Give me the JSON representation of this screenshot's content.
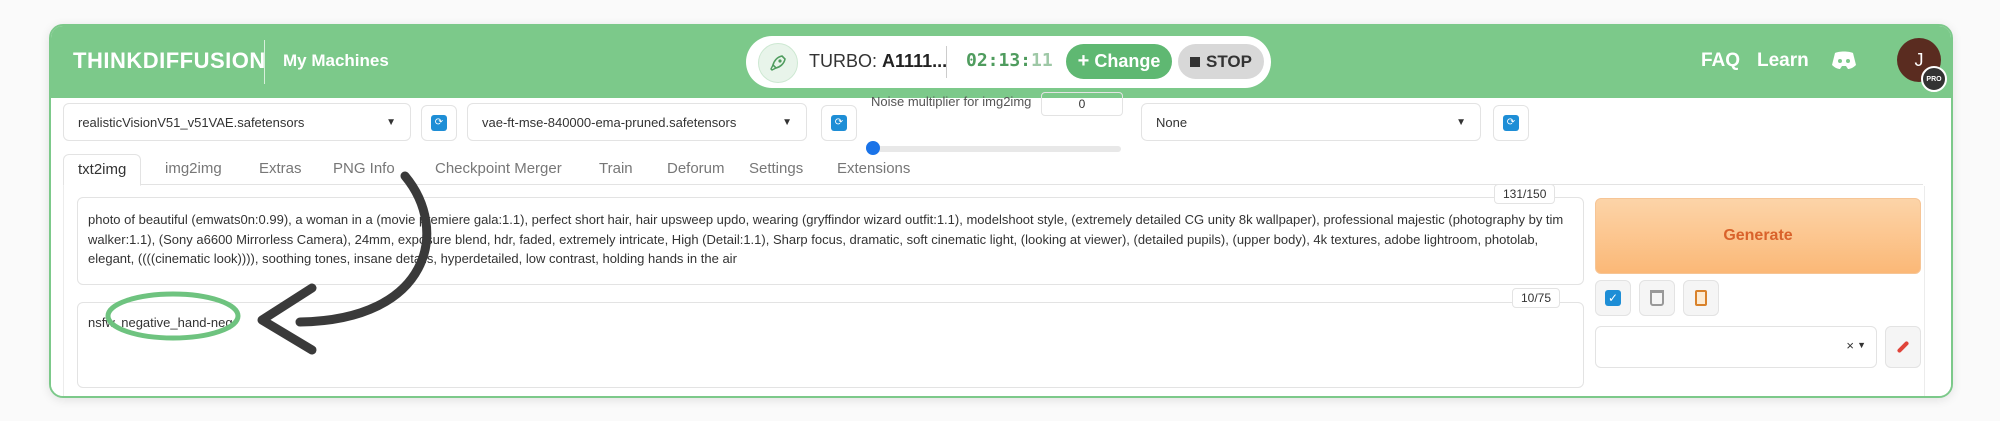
{
  "header": {
    "logo_text": "THINKDIFFUSION",
    "my_machines_label": "My Machines",
    "machine": {
      "turbo_prefix": "TURBO:",
      "turbo_name": "A1111...",
      "timer_main": "02:13:",
      "timer_seconds": "11",
      "change_label": "Change",
      "stop_label": "STOP"
    },
    "faq_label": "FAQ",
    "learn_label": "Learn",
    "avatar_initial": "J",
    "pro_badge": "PRO",
    "colors": {
      "brand_green": "#7cc98a",
      "change_green": "#5fb872"
    }
  },
  "settings": {
    "checkpoint": "realisticVisionV51_v51VAE.safetensors",
    "vae": "vae-ft-mse-840000-ema-pruned.safetensors",
    "noise_label": "Noise multiplier for img2img",
    "noise_value": "0",
    "hypernetwork": "None"
  },
  "tabs": [
    "txt2img",
    "img2img",
    "Extras",
    "PNG Info",
    "Checkpoint Merger",
    "Train",
    "Deforum",
    "Settings",
    "Extensions"
  ],
  "prompt": {
    "text": "photo of beautiful (emwats0n:0.99), a woman in a (movie premiere gala:1.1), perfect short hair, hair upsweep updo, wearing (gryffindor wizard outfit:1.1), modelshoot style, (extremely detailed CG unity 8k wallpaper), professional majestic (photography by tim walker:1.1), (Sony a6600 Mirrorless Camera), 24mm, exposure blend, hdr, faded, extremely intricate, High (Detail:1.1), Sharp focus, dramatic, soft cinematic light, (looking at viewer), (detailed pupils), (upper body), 4k textures, adobe lightroom, photolab, elegant, ((((cinematic look)))), soothing tones, insane details, hyperdetailed, low contrast, holding hands in the air",
    "counter": "131/150"
  },
  "negative_prompt": {
    "text": "nsfw, negative_hand-neg",
    "counter": "10/75"
  },
  "generate_label": "Generate",
  "style_clear": "×"
}
